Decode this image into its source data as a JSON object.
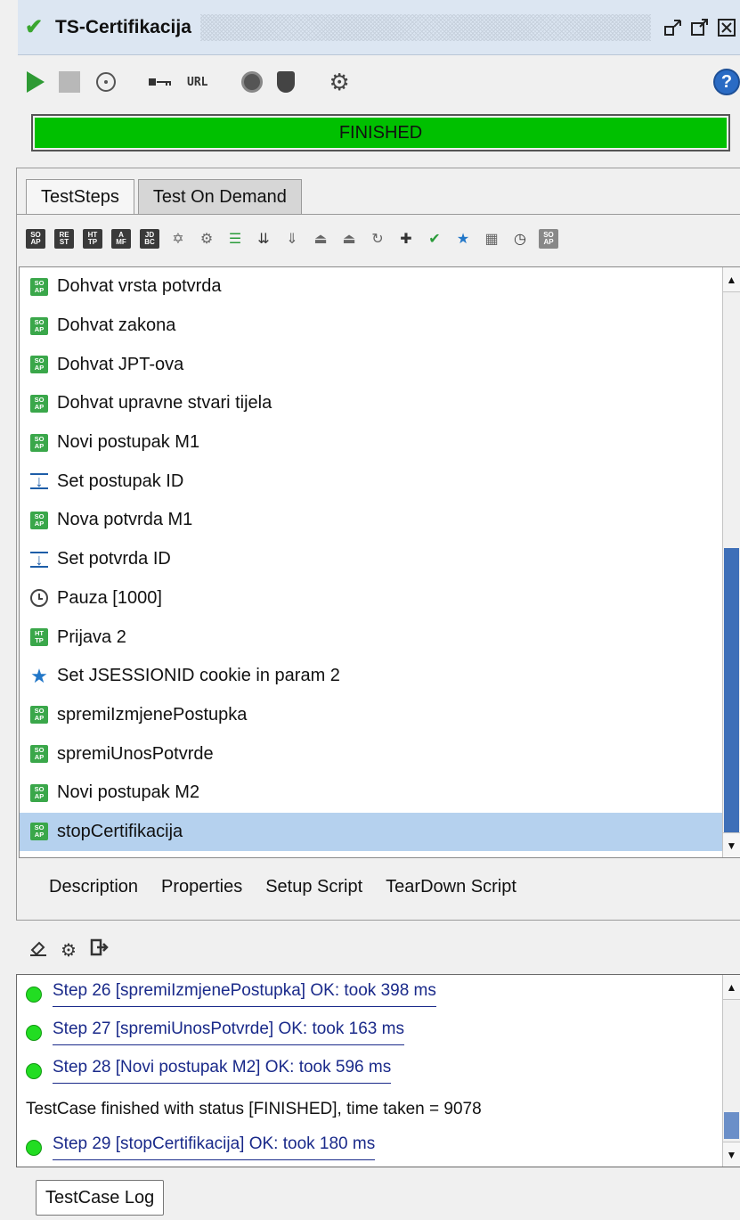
{
  "window": {
    "title": "TS-Certifikacija",
    "controls": [
      "restore-icon",
      "maximize-icon",
      "close-icon"
    ]
  },
  "toolbar": {
    "key_label": "🗝",
    "url_label": "URL",
    "help_label": "?"
  },
  "status": {
    "text": "FINISHED",
    "color": "#00c000",
    "progress": 1.0
  },
  "tabs": [
    {
      "label": "TestSteps",
      "active": true
    },
    {
      "label": "Test On Demand",
      "active": false
    }
  ],
  "steps": [
    {
      "label": "Dohvat vrsta potvrda",
      "icon": "soap-icon"
    },
    {
      "label": "Dohvat zakona",
      "icon": "soap-icon"
    },
    {
      "label": "Dohvat JPT-ova",
      "icon": "soap-icon"
    },
    {
      "label": "Dohvat upravne stvari tijela",
      "icon": "soap-icon"
    },
    {
      "label": "Novi postupak M1",
      "icon": "soap-icon"
    },
    {
      "label": "Set postupak ID",
      "icon": "property-transfer-icon"
    },
    {
      "label": "Nova potvrda M1",
      "icon": "soap-icon"
    },
    {
      "label": "Set potvrda ID",
      "icon": "property-transfer-icon"
    },
    {
      "label": "Pauza [1000]",
      "icon": "clock-icon"
    },
    {
      "label": "Prijava 2",
      "icon": "http-icon"
    },
    {
      "label": "Set JSESSIONID cookie in param 2",
      "icon": "star-icon"
    },
    {
      "label": "spremiIzmjenePostupka",
      "icon": "soap-icon"
    },
    {
      "label": "spremiUnosPotvrde",
      "icon": "soap-icon"
    },
    {
      "label": "Novi postupak M2",
      "icon": "soap-icon"
    },
    {
      "label": "stopCertifikacija",
      "icon": "soap-icon",
      "selected": true
    }
  ],
  "subtabs": [
    "Description",
    "Properties",
    "Setup Script",
    "TearDown Script"
  ],
  "log": [
    {
      "text": "Step 26 [spremiIzmjenePostupka] OK: took 398 ms",
      "status": "ok"
    },
    {
      "text": "Step 27 [spremiUnosPotvrde] OK: took 163 ms",
      "status": "ok"
    },
    {
      "text": "Step 28 [Novi postupak M2] OK: took 596 ms",
      "status": "ok"
    },
    {
      "text": "TestCase finished with status [FINISHED], time taken = 9078",
      "status": "none"
    },
    {
      "text": "Step 29 [stopCertifikacija] OK: took 180 ms",
      "status": "ok"
    }
  ],
  "log_tab": "TestCase Log",
  "icon_text": {
    "soap": "SO AP",
    "http": "HT TP",
    "rest": "RE ST",
    "amf": "A MF",
    "jdbc": "JD BC",
    "soap_step": "SO AP"
  }
}
